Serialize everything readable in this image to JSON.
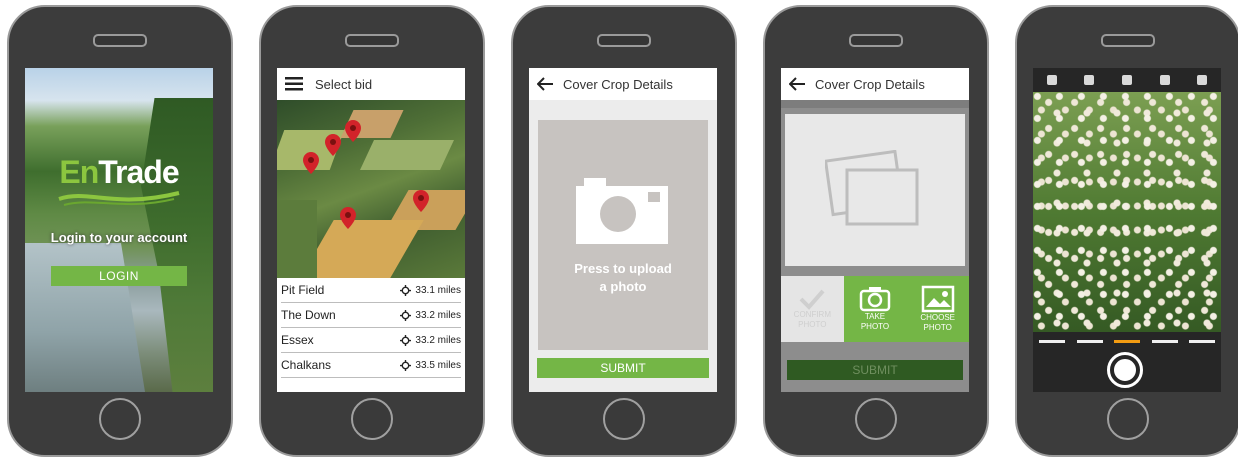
{
  "phone1": {
    "logo_prefix": "En",
    "logo_suffix": "Trade",
    "login_prompt": "Login to your account",
    "login_button": "LOGIN"
  },
  "phone2": {
    "header_title": "Select bid",
    "fields": [
      {
        "name": "Pit Field",
        "distance": "33.1 miles"
      },
      {
        "name": "The Down",
        "distance": "33.2 miles"
      },
      {
        "name": "Essex",
        "distance": "33.2 miles"
      },
      {
        "name": "Chalkans",
        "distance": "33.5 miles"
      }
    ]
  },
  "phone3": {
    "header_title": "Cover Crop Details",
    "upload_line1": "Press to upload",
    "upload_line2": "a photo",
    "submit_label": "SUBMIT"
  },
  "phone4": {
    "header_title": "Cover Crop Details",
    "confirm_line1": "CONFIRM",
    "confirm_line2": "PHOTO",
    "take_line1": "TAKE",
    "take_line2": "PHOTO",
    "choose_line1": "CHOOSE",
    "choose_line2": "PHOTO",
    "submit_label": "SUBMIT"
  },
  "colors": {
    "accent": "#74b646",
    "dark_green": "#2f5a22",
    "phone_body": "#3c3c3c"
  }
}
